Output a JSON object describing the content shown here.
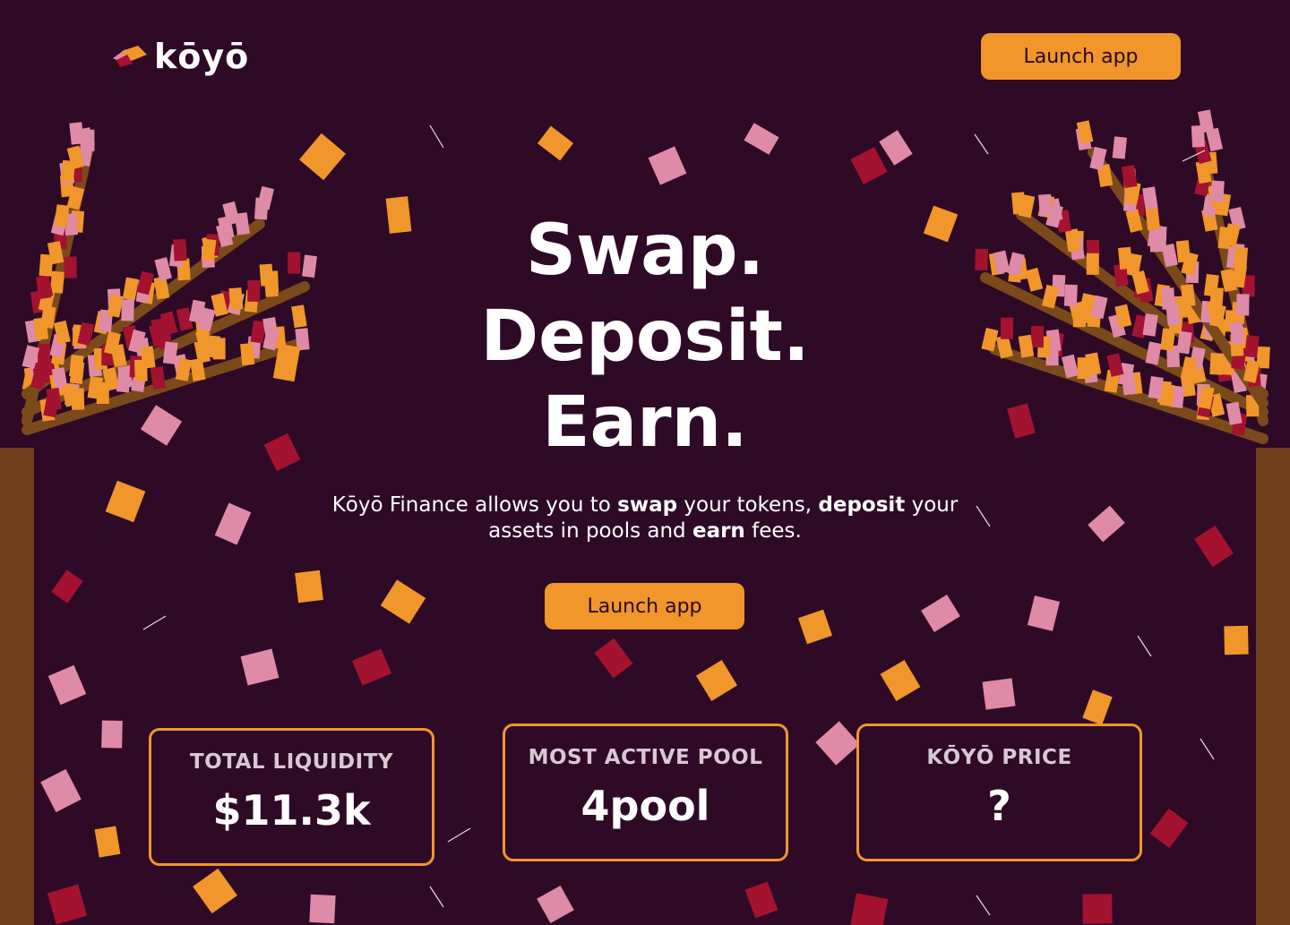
{
  "brand": {
    "name": "kōyō",
    "colors": {
      "background": "#2e0a27",
      "accent": "#f0962a",
      "pink": "#df8aa6",
      "red": "#a3122f",
      "trunk": "#7a4a1a"
    }
  },
  "header": {
    "launch_label": "Launch app"
  },
  "hero": {
    "headline": [
      "Swap.",
      "Deposit.",
      "Earn."
    ],
    "subtitle": {
      "p1": "Kōyō Finance allows you to ",
      "b1": "swap",
      "p2": " your tokens, ",
      "b2": "deposit",
      "p3": " your assets in pools and ",
      "b3": "earn",
      "p4": " fees."
    },
    "launch_label": "Launch app"
  },
  "stats": [
    {
      "label": "TOTAL LIQUIDITY",
      "value": "$11.3k"
    },
    {
      "label": "MOST ACTIVE POOL",
      "value": "4pool"
    },
    {
      "label": "KŌYŌ PRICE",
      "value": "?"
    }
  ],
  "icons": {
    "logo": "koyo-leaf-logo-icon"
  }
}
